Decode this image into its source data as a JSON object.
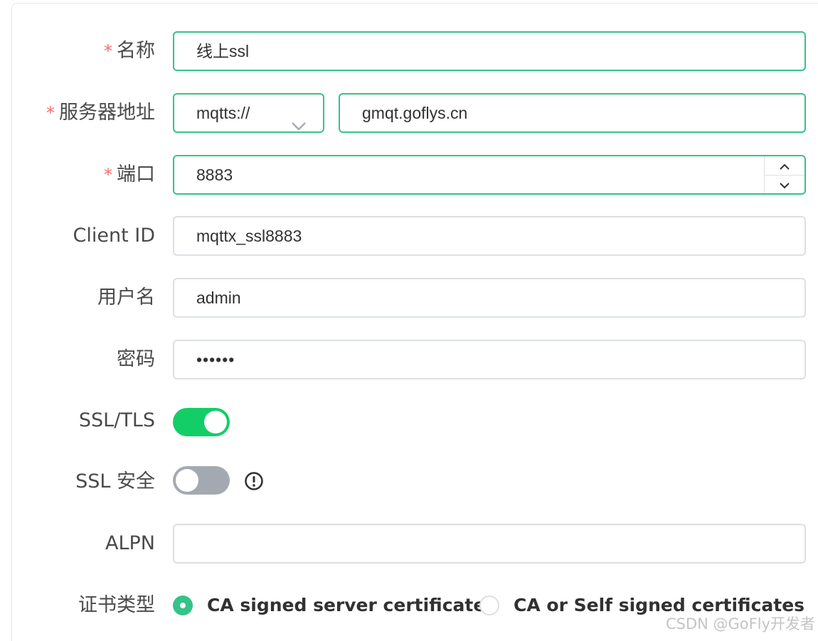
{
  "form": {
    "name": {
      "label": "名称",
      "required_mark": "*",
      "value": "线上ssl"
    },
    "host": {
      "label": "服务器地址",
      "required_mark": "*",
      "protocol": "mqtts://",
      "value": "gmqt.goflys.cn"
    },
    "port": {
      "label": "端口",
      "required_mark": "*",
      "value": "8883"
    },
    "client_id": {
      "label": "Client ID",
      "value": "mqttx_ssl8883"
    },
    "username": {
      "label": "用户名",
      "value": "admin"
    },
    "password": {
      "label": "密码",
      "value": "••••••"
    },
    "ssl_tls": {
      "label": "SSL/TLS",
      "enabled": true
    },
    "ssl_secure": {
      "label": "SSL 安全",
      "enabled": false
    },
    "alpn": {
      "label": "ALPN",
      "value": ""
    },
    "cert_type": {
      "label": "证书类型",
      "options": [
        {
          "label": "CA signed server certificate",
          "checked": true
        },
        {
          "label": "CA or Self signed certificates",
          "checked": false
        }
      ]
    }
  },
  "watermark": "CSDN @GoFly开发者",
  "colors": {
    "accent": "#34c388",
    "toggle_on": "#13ce66",
    "toggle_off": "#a4a9b1",
    "required": "#f56c6c",
    "border": "#dcdfe6"
  },
  "icons": {
    "select_arrow": "chevron-down-icon",
    "step_up": "chevron-up-icon",
    "step_down": "chevron-down-icon",
    "info": "exclamation-circle-icon"
  }
}
